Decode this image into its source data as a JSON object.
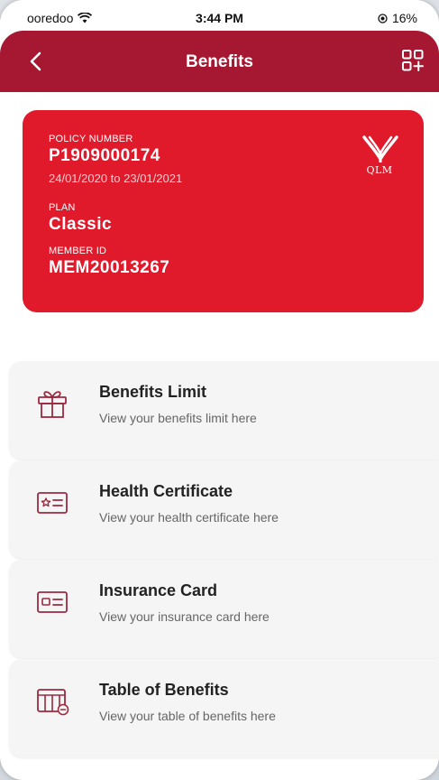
{
  "status_bar": {
    "carrier": "ooredoo",
    "time": "3:44 PM",
    "battery": "16%"
  },
  "header": {
    "title": "Benefits",
    "background_color": "#a61831"
  },
  "policy_card": {
    "policy_number_label": "POLICY NUMBER",
    "policy_number": "P1909000174",
    "dates": "24/01/2020 to 23/01/2021",
    "plan_label": "PLAN",
    "plan": "Classic",
    "member_id_label": "MEMBER ID",
    "member_id": "MEM20013267",
    "logo_text": "QLM",
    "card_color": "#e0192b"
  },
  "menu": {
    "items": [
      {
        "title": "Benefits Limit",
        "subtitle": "View your benefits limit here",
        "icon": "gift-icon"
      },
      {
        "title": "Health Certificate",
        "subtitle": "View your health certificate here",
        "icon": "certificate-icon"
      },
      {
        "title": "Insurance Card",
        "subtitle": "View your insurance card here",
        "icon": "id-card-icon"
      },
      {
        "title": "Table of Benefits",
        "subtitle": "View your table of benefits here",
        "icon": "table-icon"
      }
    ]
  }
}
